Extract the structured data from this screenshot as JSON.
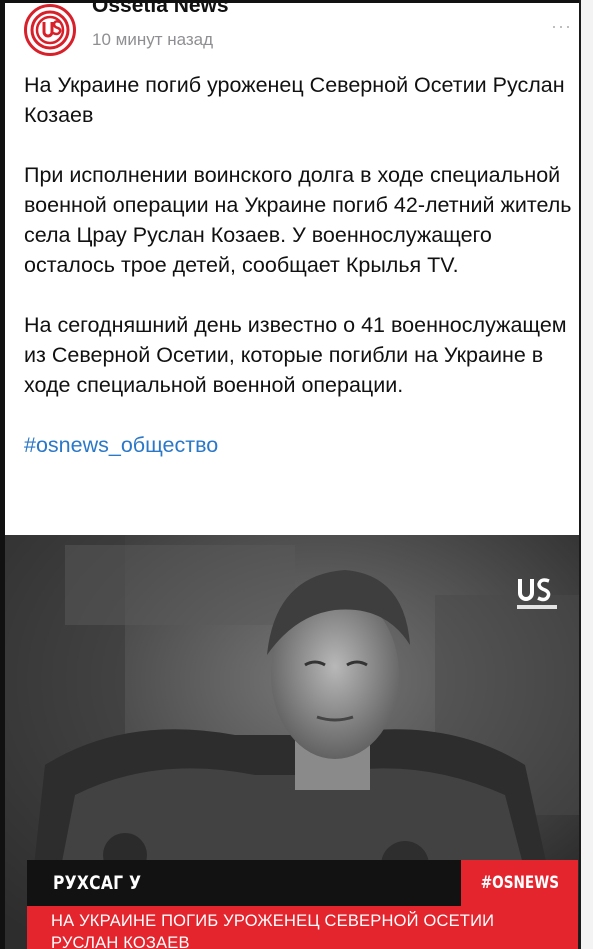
{
  "post": {
    "author": "Ossetia News",
    "time": "10 минут назад",
    "more_icon": "···",
    "paragraphs": [
      "На Украине погиб уроженец Северной Осетии Руслан Козаев",
      "При исполнении воинского долга в ходе специальной военной операции на Украине погиб 42-летний житель села Црау Руслан Козаев. У военнослужащего осталось трое детей, сообщает Крылья TV.",
      "На сегодняшний день известно о 41 военнослужащем из Северной Осетии, которые погибли на Украине в ходе специальной военной операции."
    ],
    "hashtag": "#osnews_общество"
  },
  "image": {
    "banner_label": "РУХСАГ У",
    "banner_tag": "#OSNEWS",
    "headline_line1": "НА УКРАИНЕ ПОГИБ УРОЖЕНЕЦ СЕВЕРНОЙ ОСЕТИИ",
    "headline_line2": "РУСЛАН КОЗАЕВ"
  },
  "colors": {
    "accent_red": "#e5252e",
    "link_blue": "#2b78c8",
    "muted_gray": "#8f8f93"
  },
  "icons": {
    "avatar": "ossetia-news-logo",
    "more": "more-dots-icon"
  }
}
